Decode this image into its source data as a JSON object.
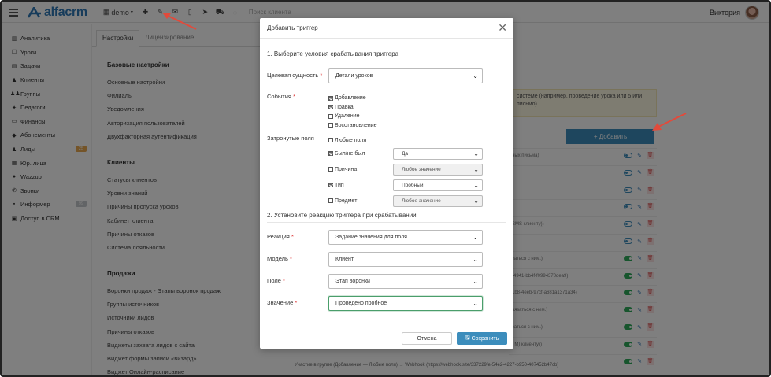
{
  "topbar": {
    "brand": "alfacrm",
    "demo_label": "demo",
    "search_placeholder": "Поиск клиента",
    "user_name": "Виктория",
    "icons": [
      "plus-icon",
      "wrench-icon",
      "mail-icon",
      "phone-icon",
      "send-icon",
      "cart-icon",
      "loader-icon"
    ]
  },
  "sidebar": {
    "items": [
      {
        "label": "Аналитика",
        "icon": "chart-icon"
      },
      {
        "label": "Уроки",
        "icon": "calendar-icon"
      },
      {
        "label": "Задачи",
        "icon": "tasks-icon"
      },
      {
        "label": "Клиенты",
        "icon": "user-icon"
      },
      {
        "label": "Группы",
        "icon": "users-icon"
      },
      {
        "label": "Педагоги",
        "icon": "teacher-icon"
      },
      {
        "label": "Финансы",
        "icon": "money-icon"
      },
      {
        "label": "Абонементы",
        "icon": "tag-icon"
      },
      {
        "label": "Лиды",
        "icon": "leads-icon",
        "badge": "25"
      },
      {
        "label": "Юр. лица",
        "icon": "building-icon"
      },
      {
        "label": "Wazzup",
        "icon": "whatsapp-icon"
      },
      {
        "label": "Звонки",
        "icon": "phone-icon"
      },
      {
        "label": "Информер",
        "icon": "inbox-icon",
        "badge": "99"
      },
      {
        "label": "Доступ в CRM",
        "icon": "lock-icon"
      }
    ]
  },
  "settings": {
    "tabs": [
      "Настройки",
      "Лицензирование"
    ],
    "sections": [
      {
        "title": "Базовые настройки",
        "links": [
          "Основные настройки",
          "Филиалы",
          "Уведомления",
          "Авторизация пользователей",
          "Двухфакторная аутентификация"
        ]
      },
      {
        "title": "Клиенты",
        "links": [
          "Статусы клиентов",
          "Уровни знаний",
          "Причины пропуска уроков",
          "Кабинет клиента",
          "Причины отказов",
          "Система лояльности"
        ]
      },
      {
        "title": "Продажи",
        "links": [
          "Воронки продаж - Этапы воронок продаж",
          "Группы источников",
          "Источники лидов",
          "Причины отказов",
          "Виджеты захвата лидов с сайта",
          "Виджет формы записи «визард»",
          "Виджет Онлайн-расписание"
        ]
      }
    ]
  },
  "content": {
    "notice": "системе (например, проведение урока или 5 или письмо).",
    "add_button": "+ Добавить",
    "rows": [
      {
        "text": "ных письма)",
        "on": false
      },
      {
        "text": "",
        "on": false
      },
      {
        "text": "",
        "on": false
      },
      {
        "text": "",
        "on": false
      },
      {
        "text": "SMS клиенту))",
        "on": false
      },
      {
        "text": "",
        "on": false
      },
      {
        "text": "заться с ним.)",
        "on": true
      },
      {
        "text": "-4941-bb4f-f0994370dea9)",
        "on": true
      },
      {
        "text": "1b8-4eeb-97cf-a681a1371a34)",
        "on": true
      },
      {
        "text": "вязаться с ним.)",
        "on": true
      },
      {
        "text": "заться с ним.)",
        "on": true
      },
      {
        "text": ", M) клиенту))",
        "on": true
      },
      {
        "text": "",
        "on": true
      }
    ],
    "bottom_line": "Участие в группе (Добавление — Любые поля) → Webhook (https://webhook.site/337229fe-54e2-4227-b950-407452b47cb)"
  },
  "modal": {
    "title": "Добавить триггер",
    "step1": "1. Выберите условия срабатывания триггера",
    "target_label": "Целевая сущность",
    "target_value": "Детали уроков",
    "events_label": "События",
    "events": [
      {
        "label": "Добавление",
        "checked": true
      },
      {
        "label": "Правка",
        "checked": true
      },
      {
        "label": "Удаление",
        "checked": false
      },
      {
        "label": "Восстановление",
        "checked": false
      }
    ],
    "fields_label": "Затронутые поля",
    "any_fields": "Любые поля",
    "fields": [
      {
        "label": "Был/не был",
        "checked": true,
        "value": "Да",
        "disabled": false
      },
      {
        "label": "Причина",
        "checked": false,
        "value": "Любое значение",
        "disabled": true
      },
      {
        "label": "Тип",
        "checked": true,
        "value": "Пробный",
        "disabled": false
      },
      {
        "label": "Предмет",
        "checked": false,
        "value": "Любое значение",
        "disabled": true
      }
    ],
    "step2": "2. Установите реакцию триггера при срабатывании",
    "reaction_label": "Реакция",
    "reaction_value": "Задание значения для поля",
    "model_label": "Модель",
    "model_value": "Клиент",
    "field_label": "Поле",
    "field_value": "Этап воронки",
    "value_label": "Значение",
    "value_value": "Проведено пробное",
    "cancel": "Отмена",
    "save": "Сохранить"
  },
  "colors": {
    "accent": "#3c8dbc",
    "brand": "#2e78b7",
    "annotation": "#e24a3b",
    "toggle_on": "#2eaa5b"
  }
}
